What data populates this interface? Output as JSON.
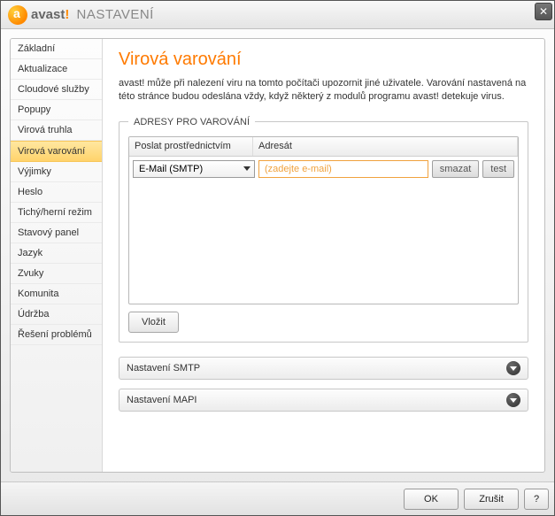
{
  "titlebar": {
    "brand": "avast",
    "excl": "!",
    "section": "NASTAVENÍ"
  },
  "sidebar": {
    "items": [
      {
        "label": "Základní"
      },
      {
        "label": "Aktualizace"
      },
      {
        "label": "Cloudové služby"
      },
      {
        "label": "Popupy"
      },
      {
        "label": "Virová truhla"
      },
      {
        "label": "Virová varování",
        "selected": true
      },
      {
        "label": "Výjimky"
      },
      {
        "label": "Heslo"
      },
      {
        "label": "Tichý/herní režim"
      },
      {
        "label": "Stavový panel"
      },
      {
        "label": "Jazyk"
      },
      {
        "label": "Zvuky"
      },
      {
        "label": "Komunita"
      },
      {
        "label": "Údržba"
      },
      {
        "label": "Řešení problémů"
      }
    ]
  },
  "page": {
    "title": "Virová varování",
    "description": "avast! může při nalezení viru na tomto počítači upozornit jiné uživatele. Varování nastavená na této stránce budou odeslána vždy, když některý z modulů programu avast! detekuje virus."
  },
  "group": {
    "legend": "ADRESY PRO VAROVÁNÍ",
    "columns": {
      "method": "Poslat prostřednictvím",
      "recipient": "Adresát"
    },
    "row": {
      "method_value": "E-Mail (SMTP)",
      "recipient_placeholder": "(zadejte e-mail)",
      "delete_label": "smazat",
      "test_label": "test"
    },
    "insert_label": "Vložit"
  },
  "expanders": {
    "smtp": "Nastavení SMTP",
    "mapi": "Nastavení MAPI"
  },
  "footer": {
    "ok": "OK",
    "cancel": "Zrušit",
    "help": "?"
  }
}
